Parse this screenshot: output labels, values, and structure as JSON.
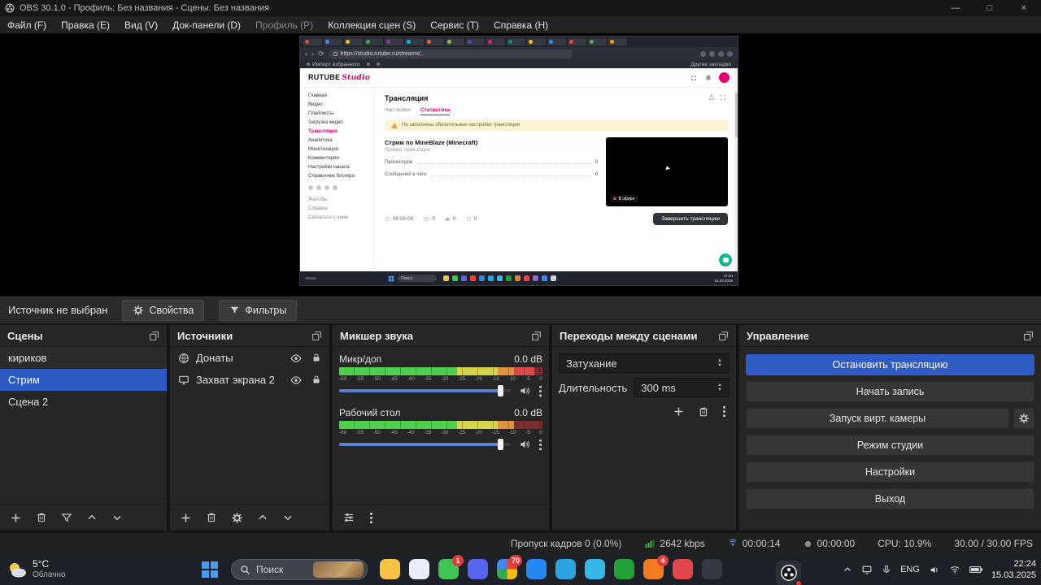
{
  "titlebar": {
    "title": "OBS 30.1.0 - Профиль: Без названия - Сцены: Без названия"
  },
  "menu": {
    "items": [
      "Файл (F)",
      "Правка (E)",
      "Вид (V)",
      "Док-панели (D)",
      "Профиль (P)",
      "Коллекция сцен (S)",
      "Сервис (T)",
      "Справка (H)"
    ]
  },
  "browser": {
    "url": "https://studio.rutube.ru/streams/…",
    "bookmark": "Импорт избранного",
    "bookmarks_right": "Другие закладки",
    "tab_colors": [
      "#e8453c",
      "#4285f4",
      "#fbbc05",
      "#34a853",
      "#9c27b0",
      "#00bcd4",
      "#ff5722",
      "#8bc34a",
      "#3f51b5",
      "#e91e63",
      "#009688",
      "#ffc107",
      "#2196f3",
      "#f44336",
      "#4caf50",
      "#ff9800"
    ],
    "dot_colors": [
      "#f6c344",
      "#3fc351",
      "#5865f2",
      "#ea4335",
      "#2787f5",
      "#2aa3e0",
      "#35b6e8",
      "#21a038",
      "#f47b20",
      "#e2474b",
      "#8f6ae0",
      "#4285f4",
      "#d0d3d8",
      "#23252b"
    ]
  },
  "rutube": {
    "logo_main": "RUTUBE",
    "logo_sub": "Studio",
    "sidebar": [
      "Главная",
      "Видео",
      "Плейлисты",
      "Загрузка видео",
      "Трансляция",
      "Аналитика",
      "Монетизация",
      "Комментарии",
      "Настройки канала",
      "Справочник блогера"
    ],
    "sidebar_bottom": [
      "Жалобы",
      "Справка",
      "Связаться с нами"
    ],
    "page_title": "Трансляция",
    "tab_settings": "Настройки",
    "tab_stats": "Статистика",
    "warning": "Не заполнены обязательные настройки трансляции",
    "stream_title": "Стрим по MineBlaze (Minecraft)",
    "stream_sub": "Прямая трансляция",
    "stat1_label": "Просмотров",
    "stat1_value": "0",
    "stat2_label": "Сообщений в чате",
    "stat2_value": "0",
    "live_badge": "В эфире",
    "timer": "00:00:00",
    "views": "0",
    "likes": "0",
    "hearts": "0",
    "end_button": "Завершить трансляцию",
    "inner_search": "Поиск",
    "clock_time": "17:04",
    "clock_date": "15.03.2025"
  },
  "source_toolbar": {
    "status": "Источник не выбран",
    "properties": "Свойства",
    "filters": "Фильтры"
  },
  "scenes": {
    "title": "Сцены",
    "items": [
      "кириков",
      "Стрим",
      "Сцена 2"
    ]
  },
  "sources": {
    "title": "Источники",
    "items": [
      "Донаты",
      "Захват экрана 2"
    ]
  },
  "mixer": {
    "title": "Микшер звука",
    "channels": [
      {
        "name": "Микр/доп",
        "db": "0.0 dB",
        "level": 0.96,
        "volume": 0.94
      },
      {
        "name": "Рабочий стол",
        "db": "0.0 dB",
        "level": 0.86,
        "volume": 0.94
      }
    ],
    "scale": [
      "-60",
      "-55",
      "-50",
      "-45",
      "-40",
      "-35",
      "-30",
      "-25",
      "-20",
      "-15",
      "-10",
      "-5",
      "0"
    ]
  },
  "transitions": {
    "title": "Переходы между сценами",
    "transition": "Затухание",
    "duration_label": "Длительность",
    "duration": "300 ms"
  },
  "controls": {
    "title": "Управление",
    "buttons": [
      "Остановить трансляцию",
      "Начать запись",
      "Запуск вирт. камеры",
      "Режим студии",
      "Настройки",
      "Выход"
    ]
  },
  "statusbar": {
    "dropped": "Пропуск кадров 0 (0.0%)",
    "bitrate": "2642 kbps",
    "stream_time": "00:00:14",
    "rec_time": "00:00:00",
    "cpu": "CPU: 10.9%",
    "fps": "30.00 / 30.00 FPS"
  },
  "taskbar": {
    "weather_temp": "5°C",
    "weather_cond": "Облачно",
    "search_label": "Поиск",
    "apps": [
      {
        "name": "file-explorer",
        "color": "#f6c344"
      },
      {
        "name": "app-light",
        "color": "#e8eef7"
      },
      {
        "name": "whatsapp",
        "color": "#3fc351",
        "badge": "1"
      },
      {
        "name": "app-indigo",
        "color": "#5865f2"
      },
      {
        "name": "chrome",
        "color": "conic-gradient(#ea4335 0 90deg, #fbbc05 90deg 180deg, #34a853 180deg 270deg, #4285f4 270deg 360deg)",
        "badge": "70"
      },
      {
        "name": "vk",
        "color": "#2787f5"
      },
      {
        "name": "telegram",
        "color": "#2aa3e0"
      },
      {
        "name": "app-cyan",
        "color": "#35b6e8"
      },
      {
        "name": "sber",
        "color": "#21a038"
      },
      {
        "name": "app-orange",
        "color": "#f47b20",
        "badge": "4"
      },
      {
        "name": "app-red",
        "color": "#e2474b"
      },
      {
        "name": "mail",
        "color": "#343943"
      }
    ],
    "lang": "ENG",
    "time": "22:24",
    "date": "15.03.2025"
  }
}
